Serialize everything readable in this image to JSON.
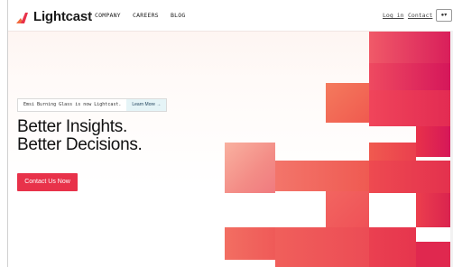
{
  "brand": {
    "name": "Lightcast",
    "accent": "#e8324a"
  },
  "nav": {
    "links": [
      "COMPANY",
      "CAREERS",
      "BLOG"
    ],
    "login": "Log in",
    "contact": "Contact",
    "language_icon": "globe-icon"
  },
  "banner": {
    "text": "Emsi Burning Glass is now Lightcast.",
    "button": "Learn More →"
  },
  "hero": {
    "line1": "Better Insights.",
    "line2": "Better Decisions.",
    "cta": "Contact Us Now"
  },
  "colors": {
    "red": "#e8324a",
    "magenta": "#d4145a",
    "coral": "#f05a4f",
    "peach": "#f7a08d"
  }
}
